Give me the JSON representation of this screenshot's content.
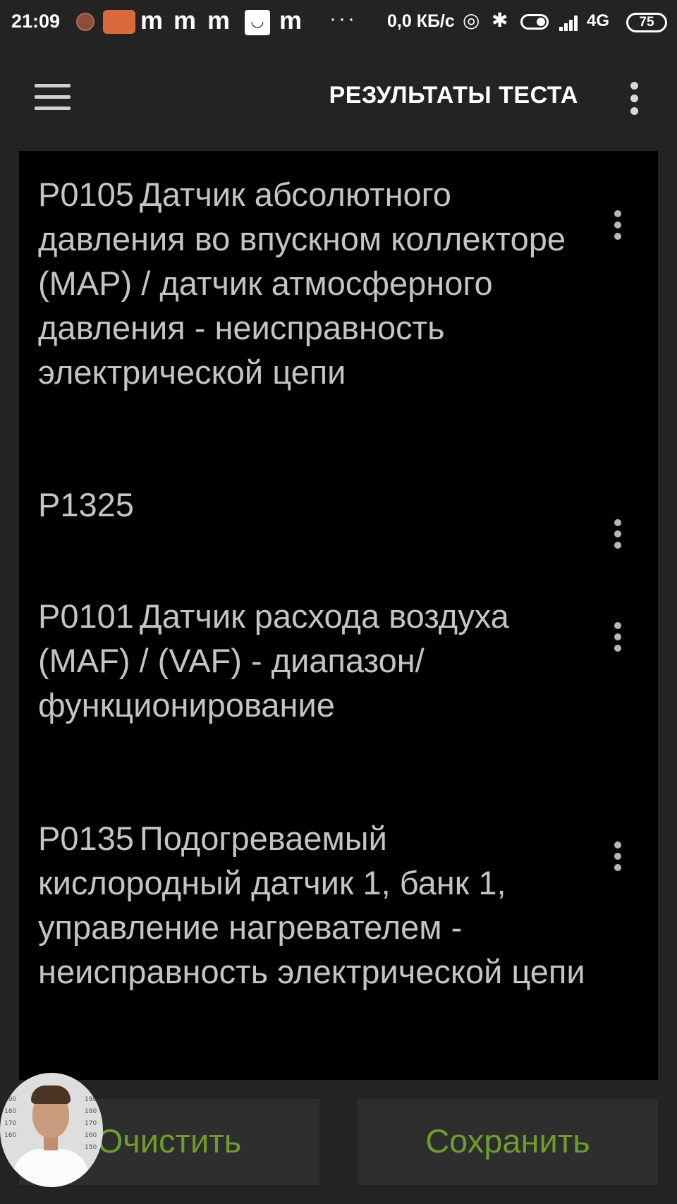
{
  "status_bar": {
    "time": "21:09",
    "notification_letters": [
      "m",
      "m",
      "m",
      "m"
    ],
    "box_glyph": "◡",
    "more_indicator": "···",
    "network_speed": "0,0 КБ/с",
    "hotspot_glyph": "◎",
    "bluetooth_glyph": "✱",
    "network_type": "4G",
    "battery_level": "75"
  },
  "app_bar": {
    "title": "РЕЗУЛЬТАТЫ ТЕСТА",
    "menu_icon": "hamburger-icon",
    "overflow_icon": "more-vert-icon"
  },
  "results": [
    {
      "code": "P0105",
      "description": "Датчик абсолютного давления во впускном коллекторе (MAP) / датчик атмосферного давления - неисправность электрической цепи"
    },
    {
      "code": "P1325",
      "description": ""
    },
    {
      "code": "P0101",
      "description": "Датчик расхода воздуха (MAF) / (VAF) - диапазон/ функционирование"
    },
    {
      "code": "P0135",
      "description": "Подогреваемый кислородный датчик 1, банк 1, управление нагревателем - неисправность электрической цепи"
    }
  ],
  "buttons": {
    "clear": "Очистить",
    "save": "Сохранить"
  },
  "colors": {
    "background": "#232323",
    "list_background": "#000000",
    "text": "#c4c4c4",
    "button_text": "#6e9c2f",
    "button_background": "#2e2e2e"
  },
  "overlay": {
    "avatar_scale_left": [
      "190",
      "180",
      "170",
      "160"
    ],
    "avatar_scale_right": [
      "190",
      "180",
      "170",
      "160",
      "150"
    ]
  }
}
